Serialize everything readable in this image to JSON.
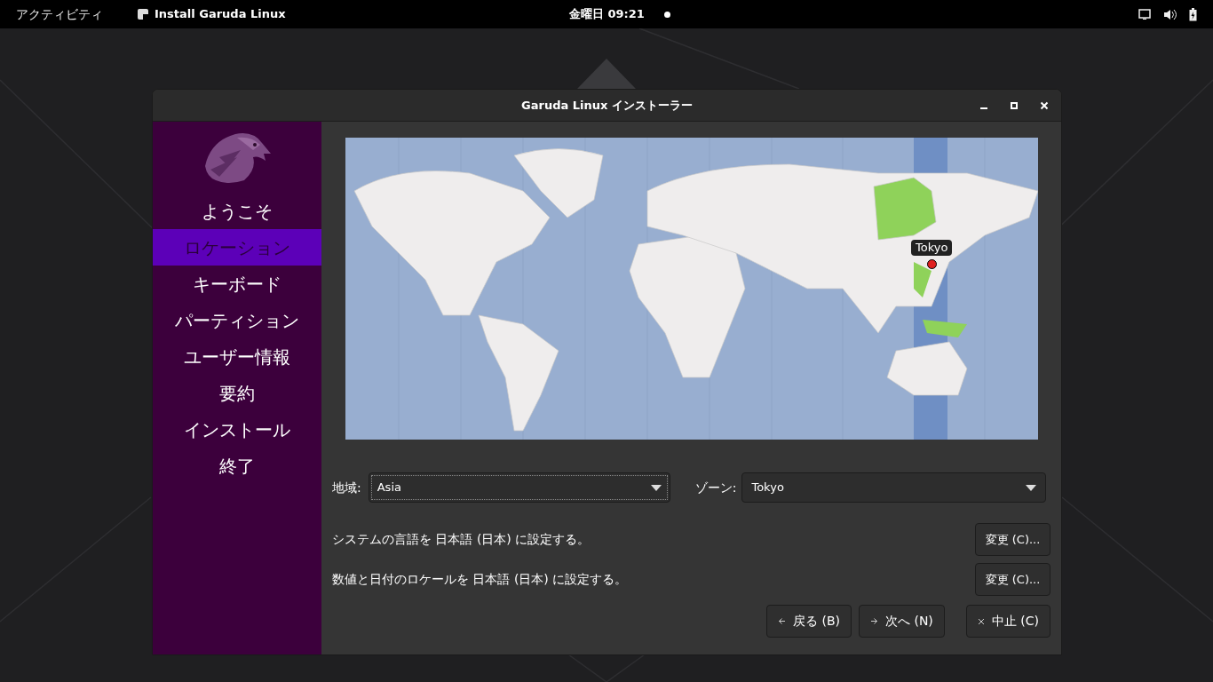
{
  "top_bar": {
    "activities": "アクティビティ",
    "app_name": "Install Garuda Linux",
    "clock": "金曜日 09:21"
  },
  "window": {
    "title": "Garuda Linux インストーラー"
  },
  "sidebar": {
    "items": [
      {
        "label": "ようこそ",
        "selected": false
      },
      {
        "label": "ロケーション",
        "selected": true
      },
      {
        "label": "キーボード",
        "selected": false
      },
      {
        "label": "パーティション",
        "selected": false
      },
      {
        "label": "ユーザー情報",
        "selected": false
      },
      {
        "label": "要約",
        "selected": false
      },
      {
        "label": "インストール",
        "selected": false
      },
      {
        "label": "終了",
        "selected": false
      }
    ]
  },
  "map": {
    "pin_label": "Tokyo"
  },
  "region": {
    "label": "地域:",
    "value": "Asia"
  },
  "zone": {
    "label": "ゾーン:",
    "value": "Tokyo"
  },
  "settings": [
    {
      "text": "システムの言語を 日本語 (日本) に設定する。",
      "button": "変更 (C)..."
    },
    {
      "text": "数値と日付のロケールを 日本語 (日本) に設定する。",
      "button": "変更 (C)..."
    }
  ],
  "buttons": [
    {
      "kind": "back",
      "label": "戻る (B)"
    },
    {
      "kind": "next",
      "label": "次へ (N)"
    },
    {
      "kind": "cancel",
      "label": "中止 (C)"
    }
  ]
}
